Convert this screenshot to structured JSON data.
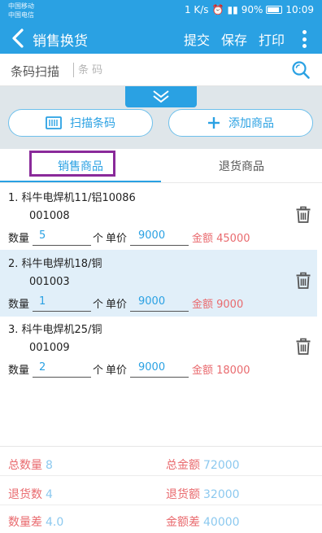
{
  "status_bar": {
    "carrier_1": "中国移动",
    "carrier_2": "中国电信",
    "speed": "1 K/s",
    "battery": "90%",
    "time": "10:09"
  },
  "app_bar": {
    "title": "销售换货",
    "submit_label": "提交",
    "save_label": "保存",
    "print_label": "打印"
  },
  "scan": {
    "label": "条码扫描",
    "placeholder": "条 码"
  },
  "tools": {
    "scan_button": "扫描条码",
    "add_button": "添加商品"
  },
  "tabs": {
    "sales": "销售商品",
    "returns": "退货商品"
  },
  "items": [
    {
      "name": "1.  科牛电焊机11/铝10086",
      "code": "001008",
      "qty_label": "数量",
      "qty": "5",
      "unit": "个",
      "price_label": "单价",
      "price": "9000",
      "amount": "金额 45000"
    },
    {
      "name": "2.  科牛电焊机18/铜",
      "code": "001003",
      "qty_label": "数量",
      "qty": "1",
      "unit": "个",
      "price_label": "单价",
      "price": "9000",
      "amount": "金额 9000"
    },
    {
      "name": "3.  科牛电焊机25/铜",
      "code": "001009",
      "qty_label": "数量",
      "qty": "2",
      "unit": "个",
      "price_label": "单价",
      "price": "9000",
      "amount": "金额 18000"
    }
  ],
  "summary": {
    "total_qty_label": "总数量",
    "total_qty": "8",
    "total_amount_label": "总金额",
    "total_amount": "72000",
    "return_qty_label": "退货数",
    "return_qty": "4",
    "return_amount_label": "退货额",
    "return_amount": "32000",
    "qty_diff_label": "数量差",
    "qty_diff": "4.0",
    "amount_diff_label": "金额差",
    "amount_diff": "40000"
  },
  "colors": {
    "primary": "#2aa1e3",
    "amount_red": "#e96a6e",
    "selected_row": "#e1eff9",
    "highlight_box": "#8a2a9a"
  }
}
